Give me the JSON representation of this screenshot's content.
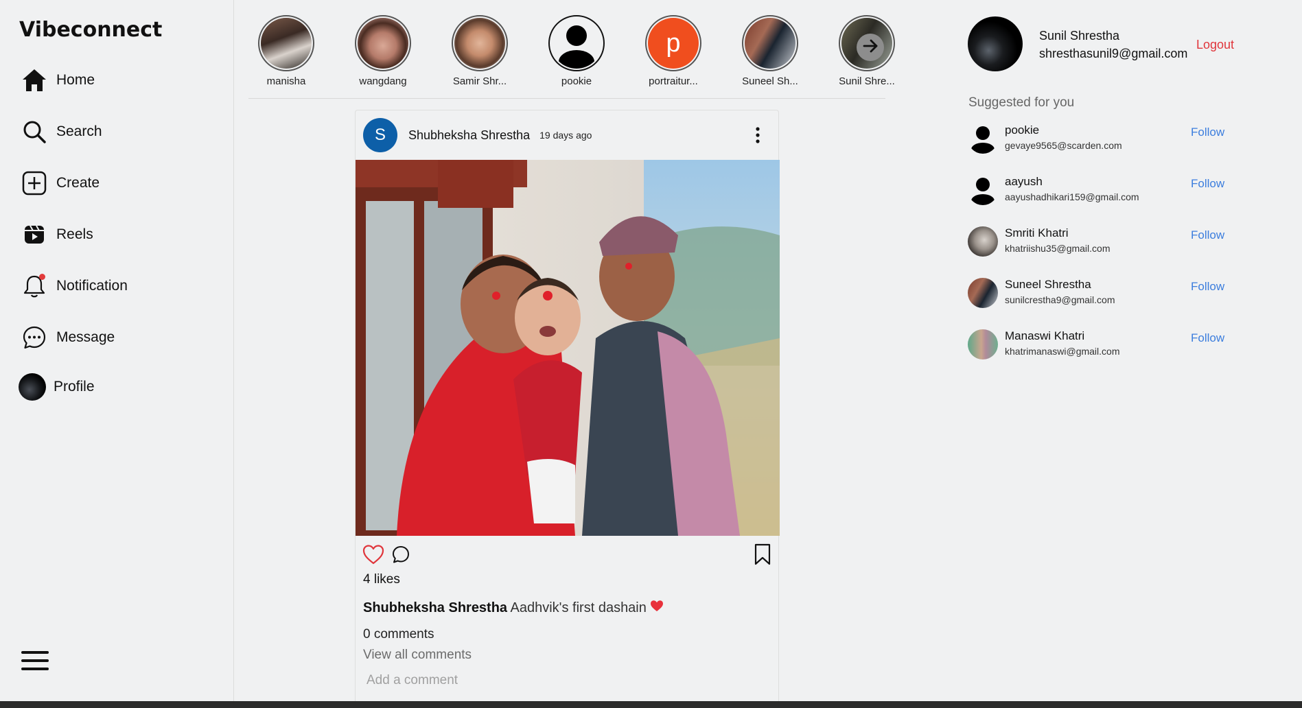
{
  "brand": "Vibeconnect",
  "nav": {
    "home": "Home",
    "search": "Search",
    "create": "Create",
    "reels": "Reels",
    "notification": "Notification",
    "message": "Message",
    "profile": "Profile"
  },
  "stories": [
    {
      "name": "manisha"
    },
    {
      "name": "wangdang"
    },
    {
      "name": "Samir Shr..."
    },
    {
      "name": "pookie"
    },
    {
      "name": "portraitur...",
      "initial": "p"
    },
    {
      "name": "Suneel Sh..."
    },
    {
      "name": "Sunil Shre..."
    }
  ],
  "post": {
    "avatar_initial": "S",
    "author": "Shubheksha Shrestha",
    "time": "19 days ago",
    "likes": "4 likes",
    "caption_author": "Shubheksha Shrestha",
    "caption_text": "Aadhvik's first dashain",
    "comments_count": "0 comments",
    "view_all": "View all comments",
    "add_comment_placeholder": "Add a comment"
  },
  "current_user": {
    "name": "Sunil Shrestha",
    "email": "shresthasunil9@gmail.com",
    "logout": "Logout"
  },
  "suggestions": {
    "title": "Suggested for you",
    "follow_label": "Follow",
    "items": [
      {
        "name": "pookie",
        "email": "gevaye9565@scarden.com"
      },
      {
        "name": "aayush",
        "email": "aayushadhikari159@gmail.com"
      },
      {
        "name": "Smriti Khatri",
        "email": "khatriishu35@gmail.com"
      },
      {
        "name": "Suneel Shrestha",
        "email": "sunilcrestha9@gmail.com"
      },
      {
        "name": "Manaswi Khatri",
        "email": "khatrimanaswi@gmail.com"
      }
    ]
  },
  "colors": {
    "accent_follow": "#3b7ddd",
    "logout": "#e0353b",
    "like": "#e0353b",
    "story_highlight": "#f04e1e",
    "post_avatar": "#0d5fa8"
  },
  "icons": {
    "home": "home-icon",
    "search": "search-icon",
    "create": "plus-square-icon",
    "reels": "reels-icon",
    "notification": "bell-icon",
    "message": "chat-bubble-icon",
    "menu": "hamburger-icon",
    "like": "heart-outline-icon",
    "comment": "comment-icon",
    "save": "bookmark-icon",
    "more": "kebab-menu-icon",
    "next": "arrow-right-icon"
  }
}
